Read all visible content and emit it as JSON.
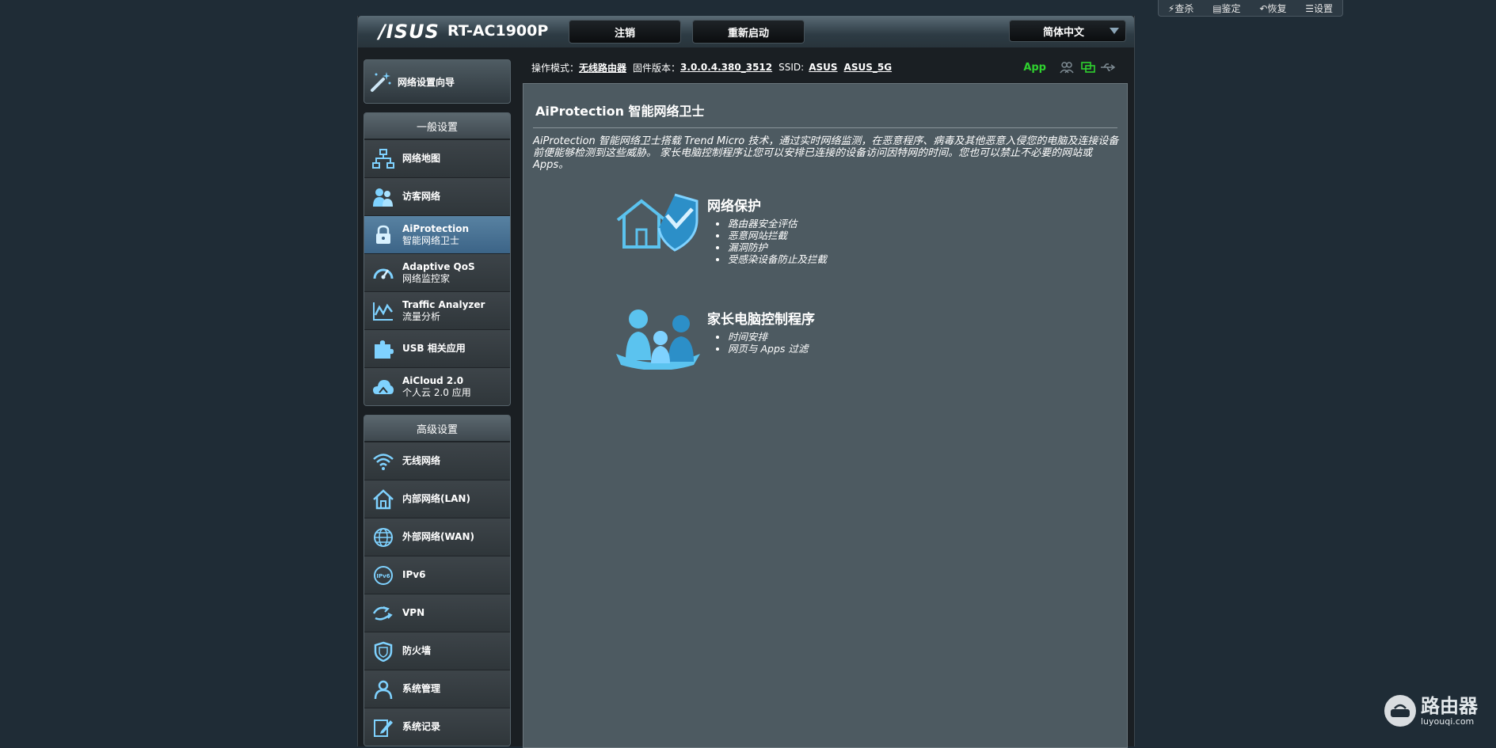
{
  "ext_toolbar": {
    "items": [
      {
        "icon": "lightning-icon",
        "label": "查杀"
      },
      {
        "icon": "document-icon",
        "label": "鉴定"
      },
      {
        "icon": "undo-icon",
        "label": "恢复"
      },
      {
        "icon": "list-icon",
        "label": "设置"
      }
    ]
  },
  "header": {
    "logo": "/ISUS",
    "model": "RT-AC1900P",
    "logout": "注销",
    "reboot": "重新启动",
    "language": "简体中文"
  },
  "infobar": {
    "mode_label": "操作模式：",
    "mode_value": "无线路由器",
    "firmware_label": "固件版本：",
    "firmware_value": "3.0.0.4.380_3512",
    "ssid_label": "SSID:",
    "ssid_1": "ASUS",
    "ssid_2": "ASUS_5G",
    "app": "App"
  },
  "sidebar": {
    "wizard": "网络设置向导",
    "general_title": "一般设置",
    "general": [
      {
        "name": "network-map",
        "icon": "network-map-icon",
        "l1": "网络地图",
        "l2": ""
      },
      {
        "name": "guest-network",
        "icon": "guest-users-icon",
        "l1": "访客网络",
        "l2": ""
      },
      {
        "name": "aiprotection",
        "icon": "lock-icon",
        "l1": "AiProtection",
        "l2": "智能网络卫士"
      },
      {
        "name": "adaptive-qos",
        "icon": "gauge-icon",
        "l1": "Adaptive QoS",
        "l2": "网络监控家"
      },
      {
        "name": "traffic-analyzer",
        "icon": "chart-icon",
        "l1": "Traffic Analyzer",
        "l2": "流量分析"
      },
      {
        "name": "usb-apps",
        "icon": "puzzle-icon",
        "l1": "USB 相关应用",
        "l2": ""
      },
      {
        "name": "aicloud",
        "icon": "cloud-icon",
        "l1": "AiCloud 2.0",
        "l2": "个人云 2.0 应用"
      }
    ],
    "advanced_title": "高级设置",
    "advanced": [
      {
        "name": "wireless",
        "icon": "wifi-icon",
        "l1": "无线网络"
      },
      {
        "name": "lan",
        "icon": "home-icon",
        "l1": "内部网络(LAN)"
      },
      {
        "name": "wan",
        "icon": "globe-icon",
        "l1": "外部网络(WAN)"
      },
      {
        "name": "ipv6",
        "icon": "ipv6-icon",
        "l1": "IPv6"
      },
      {
        "name": "vpn",
        "icon": "vpn-icon",
        "l1": "VPN"
      },
      {
        "name": "firewall",
        "icon": "shield-icon",
        "l1": "防火墙"
      },
      {
        "name": "administration",
        "icon": "admin-user-icon",
        "l1": "系统管理"
      },
      {
        "name": "system-log",
        "icon": "log-pen-icon",
        "l1": "系统记录"
      }
    ]
  },
  "content": {
    "title": "AiProtection 智能网络卫士",
    "description": "AiProtection 智能网络卫士搭载 Trend Micro 技术，通过实时网络监测，在恶意程序、病毒及其他恶意入侵您的电脑及连接设备前便能够检测到这些威胁。 家长电脑控制程序让您可以安排已连接的设备访问因特网的时间。您也可以禁止不必要的网站或 Apps。",
    "feature1": {
      "title": "网络保护",
      "items": [
        "路由器安全评估",
        "恶意网站拦截",
        "漏洞防护",
        "受感染设备防止及拦截"
      ]
    },
    "feature2": {
      "title": "家长电脑控制程序",
      "items": [
        "时间安排",
        "网页与 Apps 过滤"
      ]
    }
  },
  "watermark": {
    "cn": "路由器",
    "en": "luyouqi.com"
  }
}
